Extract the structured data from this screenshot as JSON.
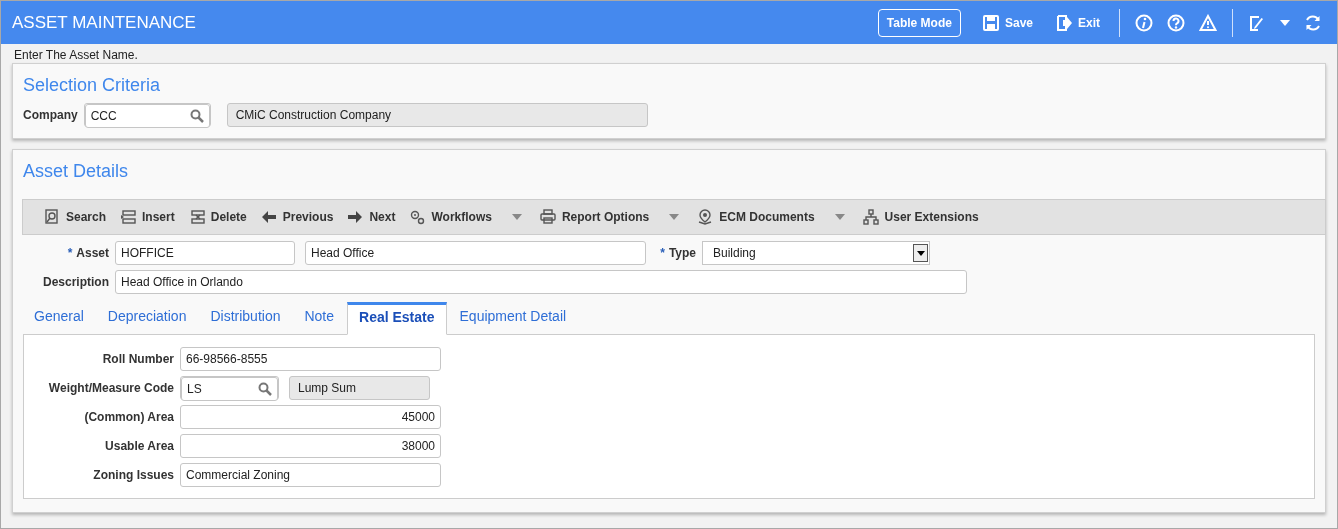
{
  "header": {
    "title": "ASSET MAINTENANCE",
    "actions": [
      {
        "kind": "outline",
        "label": "Table Mode"
      },
      {
        "kind": "save",
        "label": "Save"
      },
      {
        "kind": "exit",
        "label": "Exit"
      },
      {
        "kind": "sep"
      },
      {
        "kind": "info"
      },
      {
        "kind": "help"
      },
      {
        "kind": "warning"
      },
      {
        "kind": "sep"
      },
      {
        "kind": "edit"
      },
      {
        "kind": "caret"
      },
      {
        "kind": "refresh"
      }
    ]
  },
  "hint": "Enter The Asset Name.",
  "selection": {
    "title": "Selection Criteria",
    "company_label": "Company",
    "company_value": "CCC",
    "company_name": "CMiC Construction Company"
  },
  "details": {
    "title": "Asset Details",
    "toolbar": [
      {
        "kind": "search",
        "label": "Search",
        "dropdown": false
      },
      {
        "kind": "insert",
        "label": "Insert",
        "dropdown": false
      },
      {
        "kind": "delete",
        "label": "Delete",
        "dropdown": false
      },
      {
        "kind": "previous",
        "label": "Previous",
        "dropdown": false
      },
      {
        "kind": "next",
        "label": "Next",
        "dropdown": false
      },
      {
        "kind": "gears",
        "label": "Workflows",
        "dropdown": true
      },
      {
        "kind": "print",
        "label": "Report Options",
        "dropdown": true
      },
      {
        "kind": "ecm",
        "label": "ECM Documents",
        "dropdown": true
      },
      {
        "kind": "tree",
        "label": "User Extensions",
        "dropdown": false
      }
    ],
    "asset_mark": "*",
    "asset_label": "Asset",
    "asset_code": "HOFFICE",
    "asset_name": "Head Office",
    "type_mark": "*",
    "type_label": "Type",
    "type_value": "Building",
    "description_label": "Description",
    "description_value": "Head Office in Orlando",
    "tabs": [
      {
        "label": "General",
        "selected": false
      },
      {
        "label": "Depreciation",
        "selected": false
      },
      {
        "label": "Distribution",
        "selected": false
      },
      {
        "label": "Note",
        "selected": false
      },
      {
        "label": "Real Estate",
        "selected": true
      },
      {
        "label": "Equipment Detail",
        "selected": false
      }
    ],
    "fields": [
      {
        "kind": "text",
        "label": "Roll Number",
        "value": "66-98566-8555"
      },
      {
        "kind": "lookup",
        "label": "Weight/Measure Code",
        "value": "LS",
        "display": "Lump Sum"
      },
      {
        "kind": "number",
        "label": "(Common) Area",
        "value": "45000"
      },
      {
        "kind": "number",
        "label": "Usable Area",
        "value": "38000"
      },
      {
        "kind": "text",
        "label": "Zoning Issues",
        "value": "Commercial Zoning"
      }
    ]
  }
}
